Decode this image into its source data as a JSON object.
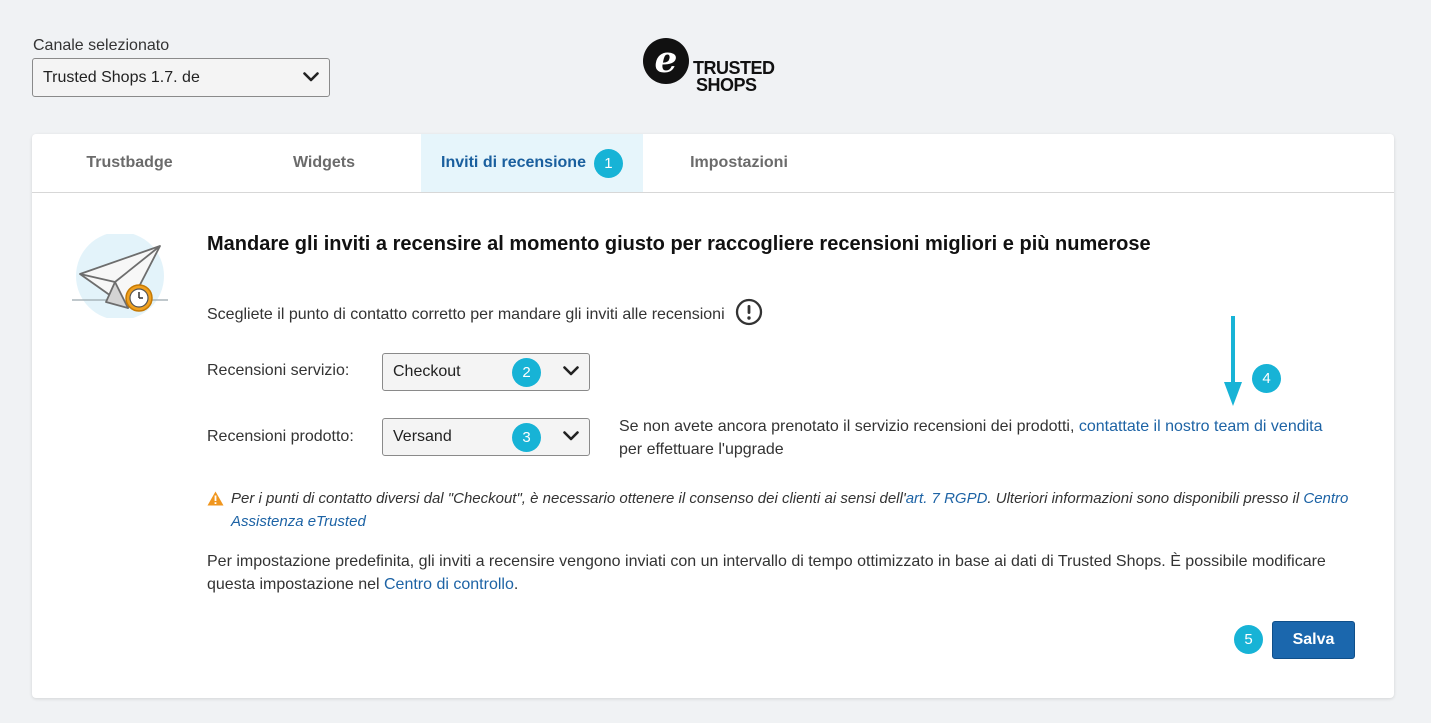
{
  "channel": {
    "label": "Canale selezionato",
    "value": "Trusted Shops 1.7. de"
  },
  "logo": {
    "mark": "e",
    "line1": "TRUSTED",
    "line2": "SHOPS"
  },
  "tabs": [
    {
      "label": "Trustbadge"
    },
    {
      "label": "Widgets"
    },
    {
      "label": "Inviti di recensione",
      "badge": "1",
      "active": true
    },
    {
      "label": "Impostazioni"
    }
  ],
  "main": {
    "heading": "Mandare gli inviti a recensire al momento giusto per raccogliere recensioni migliori e più numerose",
    "intro": "Scegliete il punto di contatto corretto per mandare gli inviti alle recensioni",
    "service": {
      "label": "Recensioni servizio:",
      "value": "Checkout",
      "badge": "2"
    },
    "product": {
      "label": "Recensioni prodotto:",
      "value": "Versand",
      "badge": "3"
    },
    "upgrade": {
      "text_before": "Se non avete ancora prenotato il servizio recensioni dei prodotti, ",
      "link": "contattate il nostro team di vendita",
      "text_after": " per effettuare l'upgrade"
    },
    "annotation_badge": "4",
    "warning": {
      "text_before": "Per i punti di contatto diversi dal \"Checkout\", è necessario ottenere il consenso dei clienti ai sensi dell'",
      "link1": "art. 7 RGPD",
      "text_middle": ". Ulteriori informazioni sono disponibili presso il ",
      "link2": "Centro Assistenza eTrusted"
    },
    "default_note": {
      "text_before": "Per impostazione predefinita, gli inviti a recensire vengono inviati con un intervallo di tempo ottimizzato in base ai dati di Trusted Shops. È possibile modificare questa impostazione nel ",
      "link": "Centro di controllo",
      "text_after": "."
    },
    "save_badge": "5",
    "save_label": "Salva"
  },
  "colors": {
    "accent": "#17b3d6",
    "primary_button": "#1b67ad",
    "link": "#1d63a5",
    "active_tab_bg": "#e6f5fb",
    "warning": "#f0961e"
  },
  "icons": [
    "chevron-down-icon",
    "info-circle-icon",
    "warning-triangle-icon",
    "arrow-down-icon",
    "paper-plane-clock-illustration"
  ]
}
